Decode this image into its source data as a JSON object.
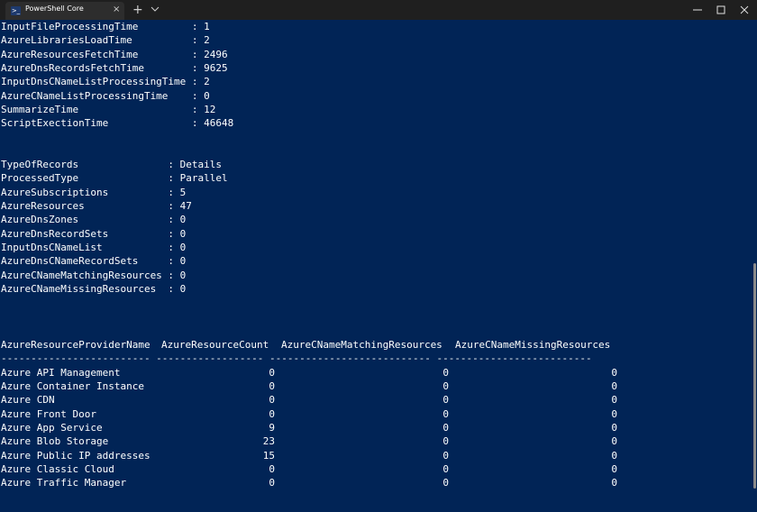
{
  "window": {
    "tab_title": "PowerShell Core",
    "tab_icon": ">_",
    "close_tab": "×",
    "new_tab": "+"
  },
  "timings": [
    {
      "key": "InputFileProcessingTime",
      "value": "1"
    },
    {
      "key": "AzureLibrariesLoadTime",
      "value": "2"
    },
    {
      "key": "AzureResourcesFetchTime",
      "value": "2496"
    },
    {
      "key": "AzureDnsRecordsFetchTime",
      "value": "9625"
    },
    {
      "key": "InputDnsCNameListProcessingTime",
      "value": "2"
    },
    {
      "key": "AzureCNameListProcessingTime",
      "value": "0"
    },
    {
      "key": "SummarizeTime",
      "value": "12"
    },
    {
      "key": "ScriptExectionTime",
      "value": "46648"
    }
  ],
  "summary": [
    {
      "key": "TypeOfRecords",
      "value": "Details"
    },
    {
      "key": "ProcessedType",
      "value": "Parallel"
    },
    {
      "key": "AzureSubscriptions",
      "value": "5"
    },
    {
      "key": "AzureResources",
      "value": "47"
    },
    {
      "key": "AzureDnsZones",
      "value": "0"
    },
    {
      "key": "AzureDnsRecordSets",
      "value": "0"
    },
    {
      "key": "InputDnsCNameList",
      "value": "0"
    },
    {
      "key": "AzureDnsCNameRecordSets",
      "value": "0"
    },
    {
      "key": "AzureCNameMatchingResources",
      "value": "0"
    },
    {
      "key": "AzureCNameMissingResources",
      "value": "0"
    }
  ],
  "table": {
    "headers": [
      "AzureResourceProviderName",
      "AzureResourceCount",
      "AzureCNameMatchingResources",
      "AzureCNameMissingResources"
    ],
    "separator": "------------------------- ------------------ --------------------------- --------------------------",
    "rows": [
      [
        "Azure API Management",
        "0",
        "0",
        "0"
      ],
      [
        "Azure Container Instance",
        "0",
        "0",
        "0"
      ],
      [
        "Azure CDN",
        "0",
        "0",
        "0"
      ],
      [
        "Azure Front Door",
        "0",
        "0",
        "0"
      ],
      [
        "Azure App Service",
        "9",
        "0",
        "0"
      ],
      [
        "Azure Blob Storage",
        "23",
        "0",
        "0"
      ],
      [
        "Azure Public IP addresses",
        "15",
        "0",
        "0"
      ],
      [
        "Azure Classic Cloud",
        "0",
        "0",
        "0"
      ],
      [
        "Azure Traffic Manager",
        "0",
        "0",
        "0"
      ]
    ]
  }
}
